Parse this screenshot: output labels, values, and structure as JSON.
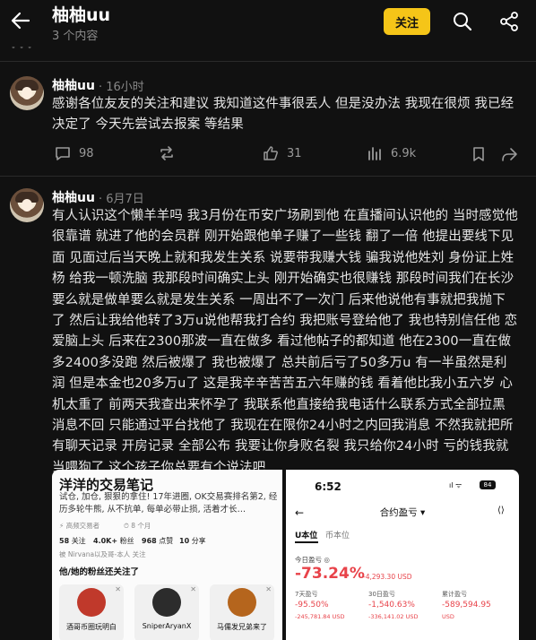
{
  "header": {
    "title": "柚柚uu",
    "subtitle": "3 个内容",
    "follow_label": "关注",
    "cut_text": "• • •"
  },
  "posts": [
    {
      "author": "柚柚uu",
      "time": "· 16小时",
      "text": "感谢各位友友的关注和建议 我知道这件事很丢人 但是没办法 我现在很烦 我已经决定了 今天先尝试去报案 等结果",
      "actions": {
        "comments": "98",
        "reposts": "",
        "likes": "31",
        "views": "6.9k"
      }
    },
    {
      "author": "柚柚uu",
      "time": "· 6月7日",
      "text": "有人认识这个懒羊羊吗 我3月份在币安广场刷到他 在直播间认识他的 当时感觉他很靠谱 就进了他的会员群 刚开始跟他单子赚了一些钱 翻了一倍 他提出要线下见面 见面过后当天晚上就和我发生关系 说要带我赚大钱 骗我说他姓刘 身份证上姓杨 给我一顿洗脑 我那段时间确实上头 刚开始确实也很赚钱 那段时间我们在长沙 要么就是做单要么就是发生关系 一周出不了一次门 后来他说他有事就把我抛下了 然后让我给他转了3万u说他帮我打合约 我把账号登给他了 我也特别信任他 恋爱脑上头 后来在2300那波一直在做多 看过他帖子的都知道 他在2300一直在做多2400多没跑 然后被爆了 我也被爆了 总共前后亏了50多万u 有一半虽然是利润 但是本金也20多万u了 这是我辛辛苦苦五六年赚的钱 看着他比我小五六岁 心机太重了 前两天我查出来怀孕了 我联系他直接给我电话什么联系方式全部拉黑 消息不回 只能通过平台找他了 我现在在限你24小时之内回我消息 不然我就把所有聊天记录 开房记录 全部公布 我要让你身败名裂 我只给你24小时 亏的钱我就当喂狗了 这个孩子你总要有个说法吧"
    }
  ],
  "image_left": {
    "title": "洋洋的交易笔记",
    "desc": "试仓, 加仓, 狠狠的拿住! 17年进圈, OK交易赛排名第2, 经历多轮牛熊, 从不抗单, 每单必带止损, 活着才长…",
    "tag": "高频交易者",
    "tag2": "8 个月",
    "stats": [
      {
        "value": "58",
        "label": "关注"
      },
      {
        "value": "4.0K+",
        "label": "粉丝"
      },
      {
        "value": "968",
        "label": "点赞"
      },
      {
        "value": "10",
        "label": "分享"
      }
    ],
    "followed_by": "被 Nirvana以及哥-本人 关注",
    "section": "他/她的粉丝还关注了",
    "cards": [
      {
        "name": "酒哥币圈玩明白",
        "color": "#c0392b"
      },
      {
        "name": "SniperAryanX",
        "color": "#2c2c2c"
      },
      {
        "name": "马儒发兄弟来了",
        "color": "#b5651d"
      }
    ]
  },
  "image_right": {
    "time": "6:52",
    "battery": "84",
    "signal": "ıl ᯤ",
    "back": "←",
    "title": "合约盈亏 ▾",
    "tabs": [
      "U本位",
      "币本位"
    ],
    "today_label": "今日盈亏 ◎",
    "today_pct": "-73.24%",
    "today_amount": "-4,293.30 USD",
    "columns": [
      {
        "label": "7天盈亏",
        "pct": "-95.50%",
        "amount": "-245,781.84 USD"
      },
      {
        "label": "30日盈亏",
        "pct": "-1,540.63%",
        "amount": "-336,141.02 USD"
      },
      {
        "label": "累计盈亏",
        "pct": "-589,594.95",
        "amount": "USD"
      }
    ]
  }
}
